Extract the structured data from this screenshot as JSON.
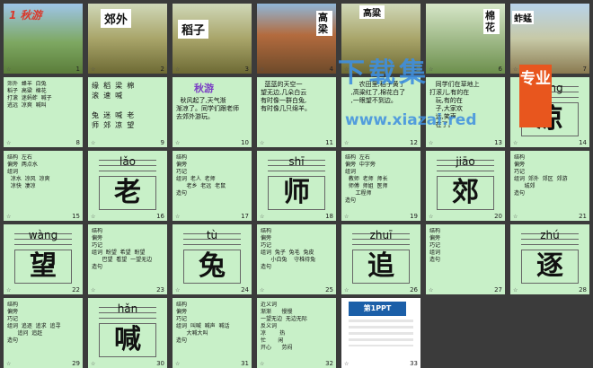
{
  "slides": [
    {
      "num": "1",
      "title": "1 秋游"
    },
    {
      "num": "2",
      "label": "郊外"
    },
    {
      "num": "3",
      "label": "稻子"
    },
    {
      "num": "4",
      "label": "高梁"
    },
    {
      "num": "5",
      "label": "高粱"
    },
    {
      "num": "6",
      "label": "棉花"
    },
    {
      "num": "7",
      "label": "蚱蜢"
    },
    {
      "num": "8",
      "text": "郊外  蜂羊  白兔\n稻子  高粱  棉花\n打滚  迷蚂蚱  喊子\n逃远  凉爽  喊叫"
    },
    {
      "num": "9",
      "text": "缘  稻  梁  棉\n滚  速  喊\n\n兔  迷  喊  老\n师  郊  凉  望"
    },
    {
      "num": "10",
      "title": "秋游",
      "text": "\n\n  秋风起了,天气渐\n渐凉了。同学们跟老师\n去郊外游玩。"
    },
    {
      "num": "11",
      "text": "  蓝蓝的天空一\n望无边,几朵白云\n有时像一群白兔,\n有时像几只绵羊。"
    },
    {
      "num": "12",
      "text": "       农田里,稻子黄了\n   ,高粱红了,棉花白了\n   ,一眼望不到边。"
    },
    {
      "num": "13",
      "text": "   同学们在草地上\n打滚儿,有的在\n   玩,有的在\n   子,大家欢\n   远,笑声\n   在了。"
    },
    {
      "num": "14",
      "pinyin": "liáng",
      "hanzi": "凉"
    },
    {
      "num": "15",
      "text": "结构  左右\n偏旁  两点水\n组词\n  凉水  凉风  凉爽\n  凉快  凄凉"
    },
    {
      "num": "16",
      "pinyin": "lǎo",
      "hanzi": "老"
    },
    {
      "num": "17",
      "text": "结构\n偏旁\n巧记\n组词  老人  老师\n      老乡  老远  老鼠\n造句"
    },
    {
      "num": "18",
      "pinyin": "shī",
      "hanzi": "师"
    },
    {
      "num": "19",
      "text": "结构  左右\n偏旁  中字旁\n组词\n  教师  老师  师长\n  师傅  师姐  医师\n      工程师\n造句"
    },
    {
      "num": "20",
      "pinyin": "jiāo",
      "hanzi": "郊"
    },
    {
      "num": "21",
      "text": "结构\n偏旁\n巧记\n组词  郊外  郊区  郊游\n      城郊\n造句"
    },
    {
      "num": "22",
      "pinyin": "wàng",
      "hanzi": "望"
    },
    {
      "num": "23",
      "text": "结构\n偏旁\n巧记\n组词  盼望  希望  盼望\n      巴望  看望  一望无边\n造句"
    },
    {
      "num": "24",
      "pinyin": "tù",
      "hanzi": "兔"
    },
    {
      "num": "25",
      "text": "结构\n偏旁\n巧记\n组词  兔子  兔毛  兔皮\n      小白兔    守株待兔\n造句"
    },
    {
      "num": "26",
      "pinyin": "zhuī",
      "hanzi": "追"
    },
    {
      "num": "27",
      "text": "结构\n偏旁\n巧记\n组词\n造句"
    },
    {
      "num": "28",
      "pinyin": "zhú",
      "hanzi": "逐"
    },
    {
      "num": "29",
      "text": "结构\n偏旁\n巧记\n组词  追逐  追求  追寻\n      追问  追赶\n造句"
    },
    {
      "num": "30",
      "pinyin": "hǎn",
      "hanzi": "喊"
    },
    {
      "num": "31",
      "text": "结构\n偏旁\n巧记\n组词  叫喊  喊声  喊话\n      大喊大叫\n造句"
    },
    {
      "num": "32",
      "text": "近义词\n渐渐      慢慢\n一望无边  无边无际\n反义词\n凉        热\n忙       闲\n开心      劳闷"
    },
    {
      "num": "33",
      "logo": "第1PPT"
    }
  ],
  "watermark": {
    "title": "下载集",
    "url": "www.xiazai.red",
    "badge": "专业"
  }
}
